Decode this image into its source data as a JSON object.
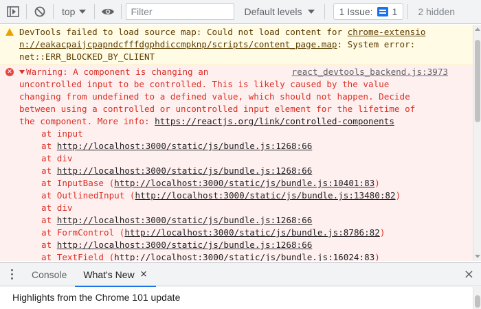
{
  "toolbar": {
    "context": "top",
    "filter_placeholder": "Filter",
    "levels": "Default levels",
    "issues": "1 Issue:",
    "issues_count": "1",
    "hidden": "2 hidden"
  },
  "warning": {
    "line1_text": "DevTools failed to load source map: Could not load content for ",
    "line1_link": "chrome-extensio",
    "line2_link": "n://eakacpaijcpapndcfffdgphdiccmpknp/scripts/content_page.map",
    "line2_text": ": System error:",
    "line3_text": "net::ERR_BLOCKED_BY_CLIENT"
  },
  "error": {
    "source_link": "react_devtools_backend.js:3973",
    "header": "Warning: A component is changing an",
    "body": "uncontrolled input to be controlled. This is likely caused by the value\nchanging from undefined to a defined value, which should not happen. Decide\nbetween using a controlled or uncontrolled input element for the lifetime of\nthe component. More info: ",
    "info_link": "https://reactjs.org/link/controlled-components",
    "stack": [
      {
        "prefix": "at input",
        "link": "",
        "suffix": ""
      },
      {
        "prefix": "at ",
        "link": "http://localhost:3000/static/js/bundle.js:1268:66",
        "suffix": ""
      },
      {
        "prefix": "at div",
        "link": "",
        "suffix": ""
      },
      {
        "prefix": "at ",
        "link": "http://localhost:3000/static/js/bundle.js:1268:66",
        "suffix": ""
      },
      {
        "prefix": "at InputBase (",
        "link": "http://localhost:3000/static/js/bundle.js:10401:83",
        "suffix": ")"
      },
      {
        "prefix": "at OutlinedInput (",
        "link": "http://localhost:3000/static/js/bundle.js:13480:82",
        "suffix": ")"
      },
      {
        "prefix": "at div",
        "link": "",
        "suffix": ""
      },
      {
        "prefix": "at ",
        "link": "http://localhost:3000/static/js/bundle.js:1268:66",
        "suffix": ""
      },
      {
        "prefix": "at FormControl (",
        "link": "http://localhost:3000/static/js/bundle.js:8786:82",
        "suffix": ")"
      },
      {
        "prefix": "at ",
        "link": "http://localhost:3000/static/js/bundle.js:1268:66",
        "suffix": ""
      },
      {
        "prefix": "at TextField (",
        "link": "http://localhost:3000/static/js/bundle.js:16024:83",
        "suffix": ")"
      }
    ]
  },
  "drawer": {
    "tabs": [
      "Console",
      "What's New"
    ],
    "close_tab": "×",
    "close_drawer": "×",
    "highlight": "Highlights from the Chrome 101 update"
  },
  "colors": {
    "accent": "#1a73e8",
    "error_text": "#d93025",
    "error_bg": "#fff0f0",
    "warning_bg": "#fffbe5",
    "warning_text": "#5c3c00"
  },
  "icons": [
    "sidebar-toggle-icon",
    "clear-console-icon",
    "eye-icon",
    "warning-icon",
    "error-icon",
    "more-options-icon",
    "close-icon"
  ]
}
